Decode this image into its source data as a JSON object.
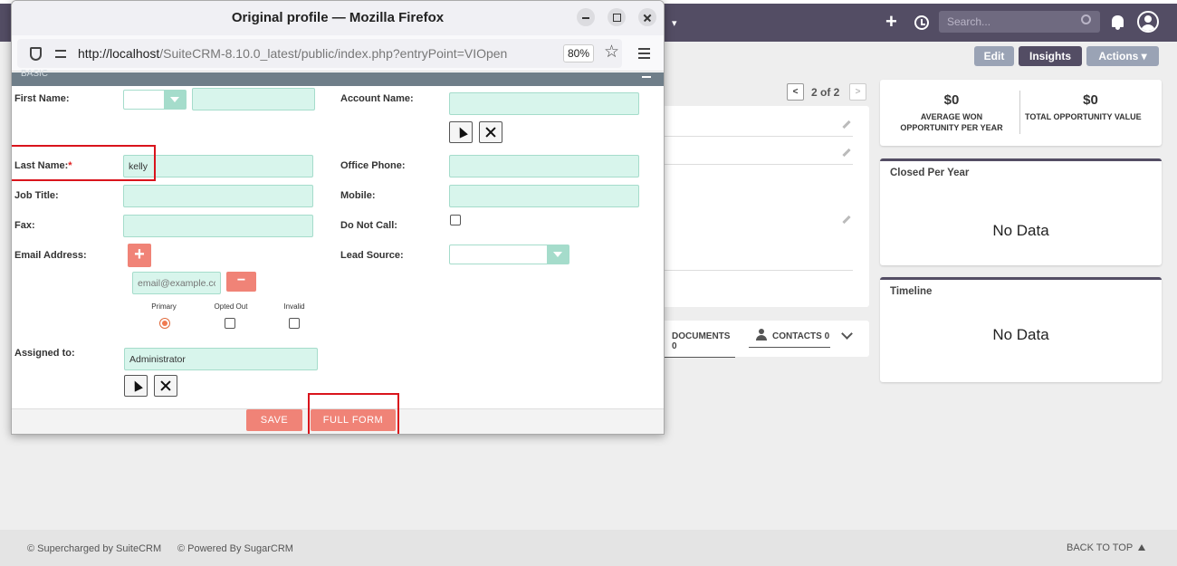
{
  "background": {
    "topnav": {
      "search_placeholder": "Search..."
    },
    "actions": {
      "edit": "Edit",
      "insights": "Insights",
      "actions": "Actions ▾"
    },
    "pager": {
      "prev": "<",
      "text": "2 of 2",
      "next": ">"
    },
    "subpanel_tabs": {
      "documents": "DOCUMENTS  0",
      "contacts": "CONTACTS  0"
    },
    "stats": {
      "avg_won_value": "$0",
      "avg_won_label": "AVERAGE WON OPPORTUNITY PER YEAR",
      "total_value": "$0",
      "total_label": "TOTAL OPPORTUNITY VALUE"
    },
    "closed_per_year": {
      "title": "Closed Per Year",
      "empty": "No Data"
    },
    "timeline": {
      "title": "Timeline",
      "empty": "No Data"
    },
    "footer": {
      "supercharged": "© Supercharged by SuiteCRM",
      "powered": "© Powered By SugarCRM",
      "back_to_top": "BACK TO TOP"
    }
  },
  "popup": {
    "window_title": "Original profile — Mozilla Firefox",
    "url_host": "http://localhost",
    "url_path": "/SuiteCRM-8.10.0_latest/public/index.php?entryPoint=VIOpen",
    "zoom": "80%",
    "section_title": "BASIC",
    "form": {
      "first_name_label": "First Name:",
      "account_name_label": "Account Name:",
      "last_name_label": "Last Name:",
      "last_name_required": "*",
      "last_name_value": "kelly",
      "office_phone_label": "Office Phone:",
      "job_title_label": "Job Title:",
      "mobile_label": "Mobile:",
      "fax_label": "Fax:",
      "do_not_call_label": "Do Not Call:",
      "email_label": "Email Address:",
      "lead_source_label": "Lead Source:",
      "email_placeholder": "email@example.com",
      "primary_label": "Primary",
      "opted_out_label": "Opted Out",
      "invalid_label": "Invalid",
      "assigned_to_label": "Assigned to:",
      "assigned_to_value": "Administrator",
      "add_email": "+",
      "remove_email": "−"
    },
    "buttons": {
      "save": "SAVE",
      "full_form": "FULL FORM"
    }
  }
}
